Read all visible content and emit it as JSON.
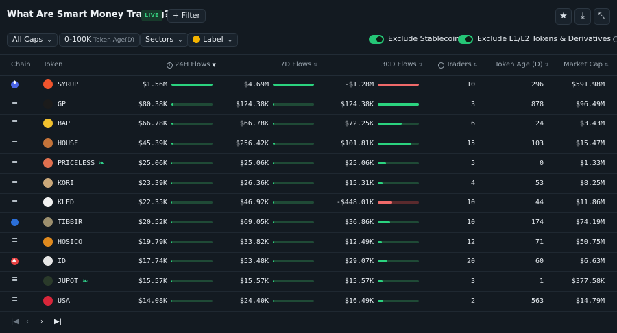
{
  "header": {
    "title": "What Are Smart Money Trading?",
    "live_badge": "LIVE",
    "filter_label": "Filter"
  },
  "filters": {
    "caps": "All Caps",
    "token_age_value": "0-100K",
    "token_age_label": "Token Age(D)",
    "sectors": "Sectors",
    "label": "Label",
    "exclude_stablecoin": "Exclude Stablecoin",
    "exclude_l1l2": "Exclude L1/L2 Tokens & Derivatives"
  },
  "columns": {
    "chain": "Chain",
    "token": "Token",
    "flows_24h": "24H Flows",
    "flows_7d": "7D Flows",
    "flows_30d": "30D Flows",
    "traders": "Traders",
    "token_age": "Token Age (D)",
    "market_cap": "Market Cap"
  },
  "colors": {
    "positive": "#2bd37f",
    "negative": "#f06a6a",
    "accent": "#25c677"
  },
  "rows": [
    {
      "chain": "eth-icon",
      "token": "SYRUP",
      "icon_color": "#f0542d",
      "f24": "$1.56M",
      "f24_frac": 1.0,
      "f7": "$4.69M",
      "f7_frac": 1.0,
      "f30": "-$1.28M",
      "f30_frac": 1.0,
      "f30_neg": true,
      "traders": "10",
      "age": "296",
      "mcap": "$591.98M",
      "leaf": false
    },
    {
      "chain": "solana-icon",
      "token": "GP",
      "icon_color": "#1b1b1b",
      "f24": "$80.38K",
      "f24_frac": 0.05,
      "f7": "$124.38K",
      "f7_frac": 0.03,
      "f30": "$124.38K",
      "f30_frac": 1.0,
      "f30_neg": false,
      "traders": "3",
      "age": "878",
      "mcap": "$96.49M",
      "leaf": false
    },
    {
      "chain": "solana-icon",
      "token": "BAP",
      "icon_color": "#f2c12e",
      "f24": "$66.78K",
      "f24_frac": 0.04,
      "f7": "$66.78K",
      "f7_frac": 0.02,
      "f30": "$72.25K",
      "f30_frac": 0.58,
      "f30_neg": false,
      "traders": "6",
      "age": "24",
      "mcap": "$3.43M",
      "leaf": false
    },
    {
      "chain": "solana-icon",
      "token": "HOUSE",
      "icon_color": "#c4733a",
      "f24": "$45.39K",
      "f24_frac": 0.03,
      "f7": "$256.42K",
      "f7_frac": 0.05,
      "f30": "$101.81K",
      "f30_frac": 0.82,
      "f30_neg": false,
      "traders": "15",
      "age": "103",
      "mcap": "$15.47M",
      "leaf": false
    },
    {
      "chain": "solana-icon",
      "token": "PRICELESS",
      "icon_color": "#e0704f",
      "f24": "$25.06K",
      "f24_frac": 0.02,
      "f7": "$25.06K",
      "f7_frac": 0.01,
      "f30": "$25.06K",
      "f30_frac": 0.2,
      "f30_neg": false,
      "traders": "5",
      "age": "0",
      "mcap": "$1.33M",
      "leaf": true
    },
    {
      "chain": "solana-icon",
      "token": "KORI",
      "icon_color": "#caa87a",
      "f24": "$23.39K",
      "f24_frac": 0.015,
      "f7": "$26.36K",
      "f7_frac": 0.01,
      "f30": "$15.31K",
      "f30_frac": 0.12,
      "f30_neg": false,
      "traders": "4",
      "age": "53",
      "mcap": "$8.25M",
      "leaf": false
    },
    {
      "chain": "solana-icon",
      "token": "KLED",
      "icon_color": "#f2f2f2",
      "f24": "$22.35K",
      "f24_frac": 0.015,
      "f7": "$46.92K",
      "f7_frac": 0.01,
      "f30": "-$448.01K",
      "f30_frac": 0.35,
      "f30_neg": true,
      "traders": "10",
      "age": "44",
      "mcap": "$11.86M",
      "leaf": false
    },
    {
      "chain": "base-icon",
      "token": "TIBBIR",
      "icon_color": "#9c8f6e",
      "f24": "$20.52K",
      "f24_frac": 0.013,
      "f7": "$69.05K",
      "f7_frac": 0.015,
      "f30": "$36.86K",
      "f30_frac": 0.3,
      "f30_neg": false,
      "traders": "10",
      "age": "174",
      "mcap": "$74.19M",
      "leaf": false
    },
    {
      "chain": "solana-icon",
      "token": "HOSICO",
      "icon_color": "#e08a1e",
      "f24": "$19.79K",
      "f24_frac": 0.013,
      "f7": "$33.82K",
      "f7_frac": 0.01,
      "f30": "$12.49K",
      "f30_frac": 0.1,
      "f30_neg": false,
      "traders": "12",
      "age": "71",
      "mcap": "$50.75M",
      "leaf": false
    },
    {
      "chain": "avax-icon",
      "token": "ID",
      "icon_color": "#e6e6e6",
      "f24": "$17.74K",
      "f24_frac": 0.011,
      "f7": "$53.48K",
      "f7_frac": 0.012,
      "f30": "$29.07K",
      "f30_frac": 0.24,
      "f30_neg": false,
      "traders": "20",
      "age": "60",
      "mcap": "$6.63M",
      "leaf": false
    },
    {
      "chain": "solana-icon",
      "token": "JUPOT",
      "icon_color": "#2a3a2a",
      "f24": "$15.57K",
      "f24_frac": 0.01,
      "f7": "$15.57K",
      "f7_frac": 0.005,
      "f30": "$15.57K",
      "f30_frac": 0.12,
      "f30_neg": false,
      "traders": "3",
      "age": "1",
      "mcap": "$377.58K",
      "leaf": true
    },
    {
      "chain": "solana-icon",
      "token": "USA",
      "icon_color": "#d8263a",
      "f24": "$14.08K",
      "f24_frac": 0.009,
      "f7": "$24.40K",
      "f7_frac": 0.006,
      "f30": "$16.49K",
      "f30_frac": 0.13,
      "f30_neg": false,
      "traders": "2",
      "age": "563",
      "mcap": "$14.79M",
      "leaf": false
    }
  ]
}
